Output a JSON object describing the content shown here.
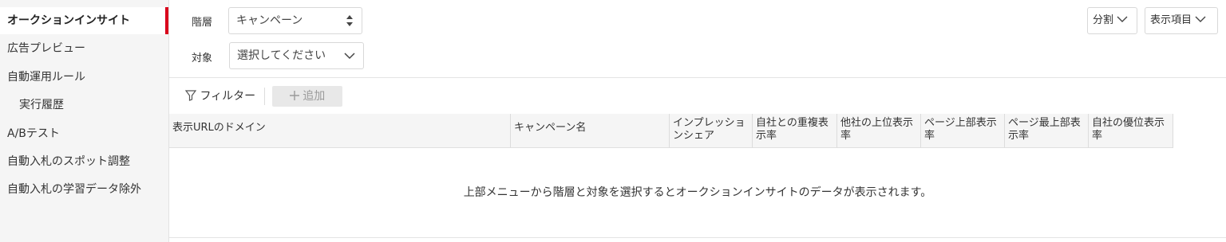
{
  "sidebar": {
    "items": [
      {
        "label": "オークションインサイト"
      },
      {
        "label": "広告プレビュー"
      },
      {
        "label": "自動運用ルール"
      },
      {
        "label": "実行履歴"
      },
      {
        "label": "A/Bテスト"
      },
      {
        "label": "自動入札のスポット調整"
      },
      {
        "label": "自動入札の学習データ除外"
      }
    ]
  },
  "controls": {
    "level_label": "階層",
    "level_value": "キャンペーン",
    "target_label": "対象",
    "target_placeholder": "選択してください",
    "split_label": "分割",
    "display_items_label": "表示項目"
  },
  "toolbar": {
    "filter_label": "フィルター",
    "add_label": "追加"
  },
  "table": {
    "columns": [
      "表示URLのドメイン",
      "キャンペーン名",
      "インプレッションシェア",
      "自社との重複表示率",
      "他社の上位表示率",
      "ページ上部表示率",
      "ページ最上部表示率",
      "自社の優位表示率"
    ],
    "empty_message": "上部メニューから階層と対象を選択するとオークションインサイトのデータが表示されます。"
  },
  "colors": {
    "accent": "#d9001b",
    "sidebar_bg": "#f5f5f5",
    "header_bg": "#f5f5f5"
  },
  "icons": {
    "level_select": "updown-arrows-icon",
    "target_select": "chevron-down-icon",
    "filter": "filter-icon",
    "add": "plus-icon"
  }
}
